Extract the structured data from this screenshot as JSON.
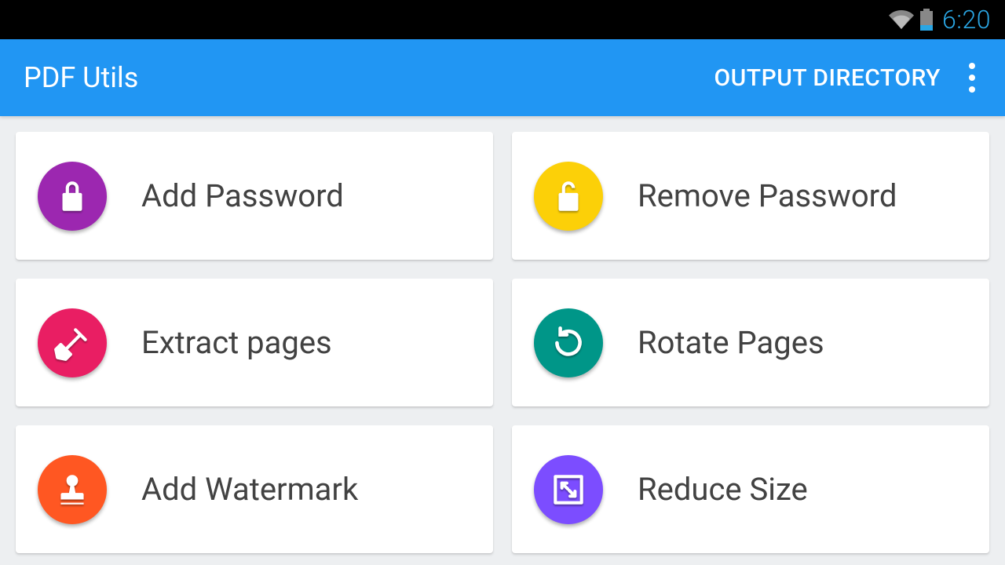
{
  "status_bar": {
    "time": "6:20"
  },
  "app_bar": {
    "title": "PDF Utils",
    "action_label": "OUTPUT DIRECTORY"
  },
  "cards": [
    {
      "label": "Add Password",
      "icon": "lock-closed-icon",
      "color": "#9c27b0"
    },
    {
      "label": "Remove Password",
      "icon": "lock-open-icon",
      "color": "#fcd008"
    },
    {
      "label": "Extract pages",
      "icon": "shovel-icon",
      "color": "#e91e63"
    },
    {
      "label": "Rotate Pages",
      "icon": "rotate-icon",
      "color": "#009688"
    },
    {
      "label": "Add Watermark",
      "icon": "stamp-icon",
      "color": "#ff5722"
    },
    {
      "label": "Reduce Size",
      "icon": "compress-icon",
      "color": "#7c4dff"
    }
  ]
}
